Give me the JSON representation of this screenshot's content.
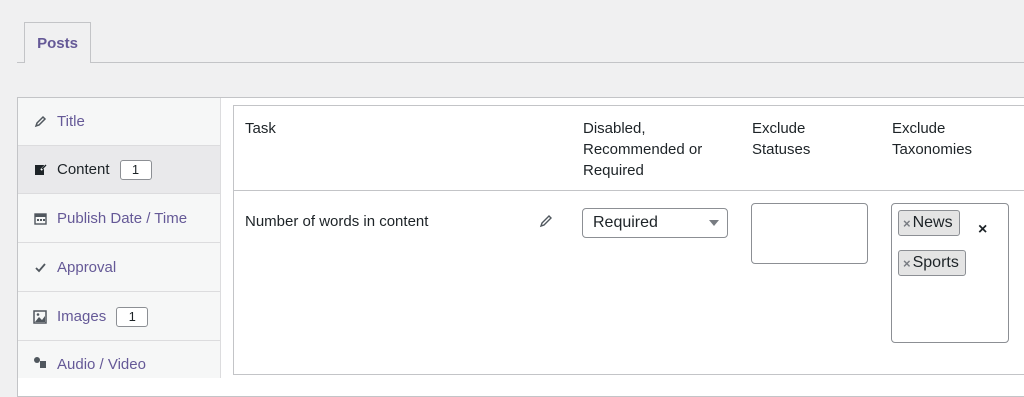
{
  "tabs": [
    {
      "label": "Posts"
    }
  ],
  "sidebar": {
    "items": [
      {
        "label": "Title",
        "icon": "pencil-icon"
      },
      {
        "label": "Content",
        "icon": "edit-page-icon",
        "count": "1"
      },
      {
        "label": "Publish Date / Time",
        "icon": "calendar-icon"
      },
      {
        "label": "Approval",
        "icon": "check-icon"
      },
      {
        "label": "Images",
        "icon": "image-icon",
        "count": "1"
      },
      {
        "label": "Audio / Video",
        "icon": "media-icon"
      }
    ],
    "active": "Content"
  },
  "table": {
    "headers": {
      "task": "Task",
      "level": [
        "Disabled,",
        "Recommended or",
        "Required"
      ],
      "statuses": [
        "Exclude",
        "Statuses"
      ],
      "taxonomies": [
        "Exclude",
        "Taxonomies"
      ]
    },
    "row": {
      "task": "Number of words in content",
      "level": "Required",
      "taxonomies": [
        "News",
        "Sports"
      ]
    }
  },
  "colors": {
    "accent": "#655997",
    "border": "#c3c4c7"
  }
}
